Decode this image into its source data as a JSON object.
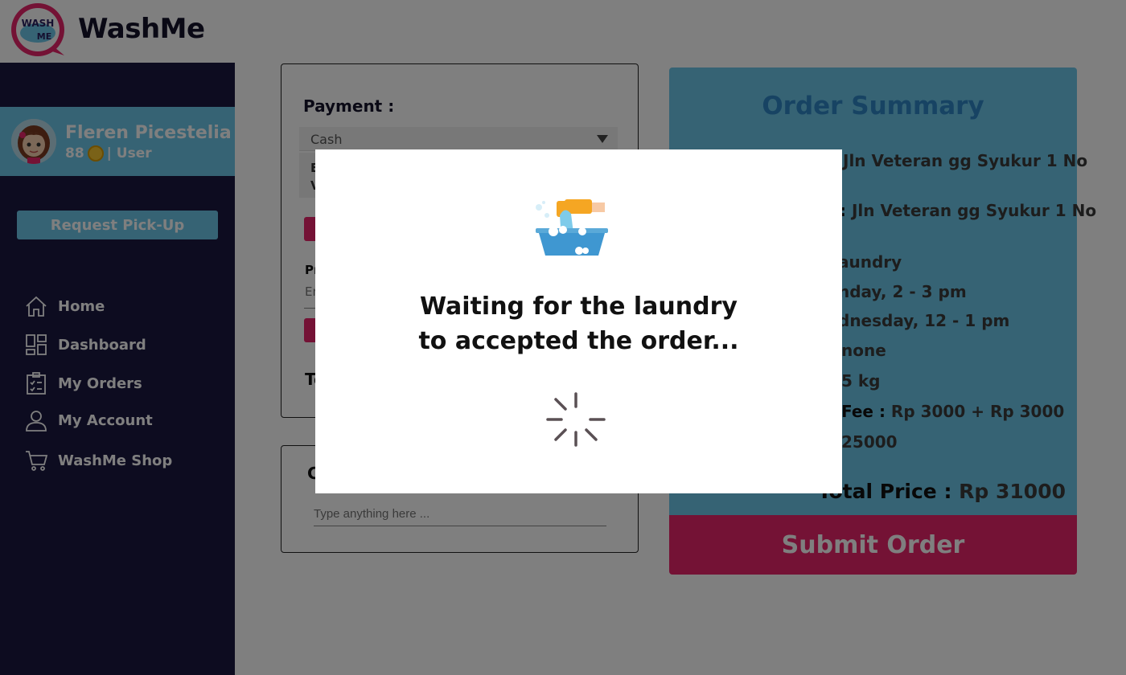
{
  "brand": {
    "name": "WashMe",
    "logo_text": "WASH ME"
  },
  "user": {
    "name": "Fleren Picestelia",
    "points": "88",
    "role": "| User"
  },
  "sidebar": {
    "pickup_label": "Request Pick-Up",
    "items": [
      {
        "label": "Home",
        "icon": "home-icon"
      },
      {
        "label": "Dashboard",
        "icon": "dashboard-icon"
      },
      {
        "label": "My Orders",
        "icon": "orders-icon"
      },
      {
        "label": "My Account",
        "icon": "account-icon"
      },
      {
        "label": "WashMe Shop",
        "icon": "cart-icon"
      }
    ]
  },
  "payment": {
    "label": "Payment :",
    "selected": "Cash",
    "list_letters": [
      "E",
      "V"
    ],
    "promo_letters": "Pr",
    "promo_placeholder_letters": "En",
    "total_letters": "To"
  },
  "notes": {
    "title_letter": "C",
    "placeholder": "Type anything here ..."
  },
  "summary": {
    "title": "Order Summary",
    "lines": [
      {
        "text": "Jln Veteran gg Syukur 1 No"
      },
      {
        "text": "Jln Veteran gg Syukur 1 No",
        "prefix": ":"
      },
      {
        "text": "aundry"
      },
      {
        "text": "nday, 2 - 3 pm"
      },
      {
        "text": "dnesday, 12 - 1 pm"
      },
      {
        "text": "none"
      },
      {
        "text": "5 kg"
      },
      {
        "text": "Rp 3000 + Rp 3000",
        "key": "Fee :"
      },
      {
        "text": "25000"
      }
    ],
    "total_key": "Total Price :",
    "total_value": "Rp 31000",
    "submit_label": "Submit Order"
  },
  "modal": {
    "line1": "Waiting for the laundry",
    "line2": "to accepted the order..."
  },
  "colors": {
    "navy": "#1b1840",
    "sky": "#6cc6e8",
    "pink": "#e8246a",
    "title_blue": "#2f87c7"
  }
}
